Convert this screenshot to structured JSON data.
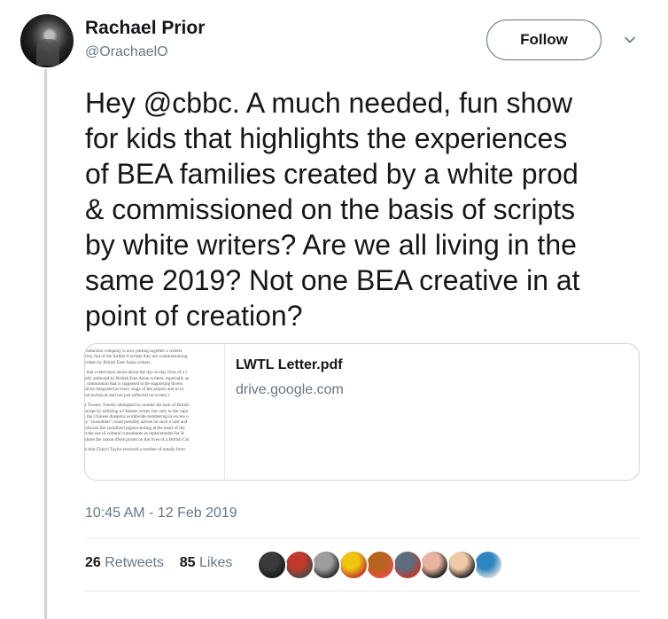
{
  "author": {
    "name": "Rachael Prior",
    "handle": "@OrachaelO"
  },
  "follow_label": "Follow",
  "tweet_text": "Hey @cbbc. A much needed, fun show\nfor kids that highlights the experiences\nof BEA families created by a white prod\n& commissioned on the basis of scripts\nby white writers? Are we all living in the\nsame 2019? Not one BEA creative in at\npoint of creation?",
  "card": {
    "title": "LWTL Letter.pdf",
    "domain": "drive.google.com",
    "preview_lines": [
      "production company is now putting together a writers",
      "eries, but of the further 8 scripts they are commissioning,",
      "written by British East Asian writers.",
      "",
      "e that a television series about the day-to-day lives of a l",
      "fully authored by British East Asian writers, especially as",
      "a commission that is supposed to be supporting divers",
      "uld be integrated at every stage of the project and in ev",
      "and technical-and not just reflected on screen.)",
      "",
      "at Twenty Twenty attempted to counter the lack of British",
      "oncept by enlisting a Chinese writer, but only in the capa",
      "n the Chinese diaspora worldwide-numbering in excess o",
      "ny \"consultant\" could possibly advise on such a vast and",
      "enforces the racialized pigeon-holing at the heart of the",
      "pt the use of cultural consultants as replacements for B",
      "where the raison d'etre pivots on the lives of a British Chi",
      "",
      "se that Cheryl Taylor received a number of emails from"
    ]
  },
  "timestamp": "10:45 AM - 12 Feb 2019",
  "stats": {
    "retweets_count": "26",
    "retweets_label": "Retweets",
    "likes_count": "85",
    "likes_label": "Likes"
  },
  "liker_avatars": [
    {
      "colors": [
        "#3a3a3a",
        "#1a1a1a"
      ]
    },
    {
      "colors": [
        "#c0392b",
        "#4a4a4a"
      ]
    },
    {
      "colors": [
        "#9e9e9e",
        "#2b2b2b"
      ]
    },
    {
      "colors": [
        "#f1c40f",
        "#c0392b"
      ]
    },
    {
      "colors": [
        "#b5651d",
        "#e74c3c"
      ]
    },
    {
      "colors": [
        "#5d6d7e",
        "#c0392b"
      ]
    },
    {
      "colors": [
        "#e8b4a0",
        "#1c1c1c"
      ]
    },
    {
      "colors": [
        "#f0c9a8",
        "#222222"
      ]
    },
    {
      "colors": [
        "#2e86c1",
        "#d5dbdb"
      ]
    }
  ]
}
